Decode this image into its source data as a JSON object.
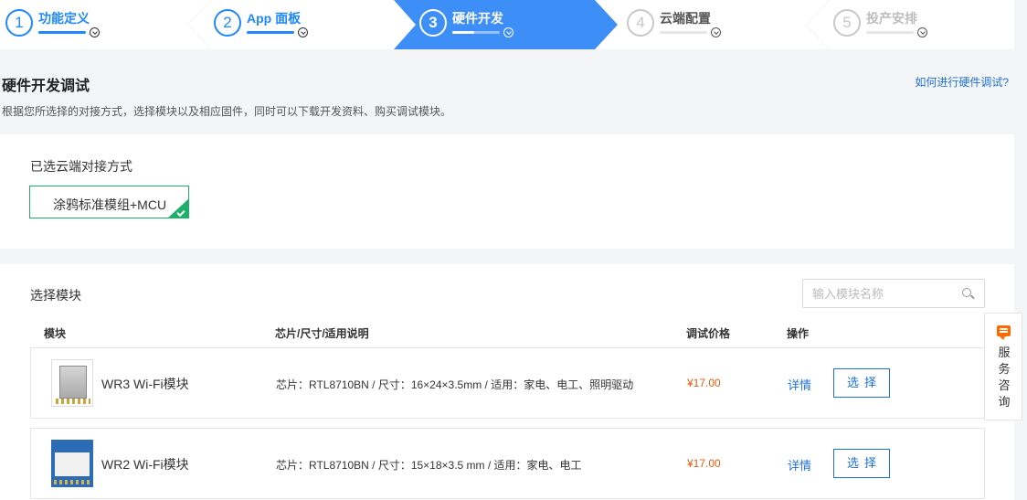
{
  "steps": [
    {
      "num": "1",
      "label": "功能定义",
      "state": "done"
    },
    {
      "num": "2",
      "label": "App 面板",
      "state": "done"
    },
    {
      "num": "3",
      "label": "硬件开发",
      "state": "active"
    },
    {
      "num": "4",
      "label": "云端配置",
      "state": "todo"
    },
    {
      "num": "5",
      "label": "投产安排",
      "state": "todo"
    }
  ],
  "header": {
    "title": "硬件开发调试",
    "help_link": "如何进行硬件调试?",
    "subtitle": "根据您所选择的对接方式，选择模块以及相应固件，同时可以下载开发资料、购买调试模块。"
  },
  "cloud_method": {
    "title": "已选云端对接方式",
    "selected": "涂鸦标准模组+MCU"
  },
  "modules": {
    "title": "选择模块",
    "search_placeholder": "输入模块名称",
    "columns": {
      "module": "模块",
      "spec": "芯片/尺寸/适用说明",
      "price": "调试价格",
      "action": "操作"
    },
    "rows": [
      {
        "name": "WR3 Wi-Fi模块",
        "spec": "芯片：RTL8710BN / 尺寸：16×24×3.5mm / 适用：家电、电工、照明驱动",
        "price": "¥17.00",
        "detail": "详情",
        "select": "选择"
      },
      {
        "name": "WR2 Wi-Fi模块",
        "spec": "芯片：RTL8710BN / 尺寸：15×18×3.5 mm / 适用：家电、电工",
        "price": "¥17.00",
        "detail": "详情",
        "select": "选择"
      }
    ]
  },
  "service": {
    "label": "服务咨询",
    "icon": "chat-icon"
  },
  "colors": {
    "primary": "#1e88ff",
    "active_step": "#3d8ef7",
    "success": "#1db06a",
    "price": "#e8590c"
  }
}
